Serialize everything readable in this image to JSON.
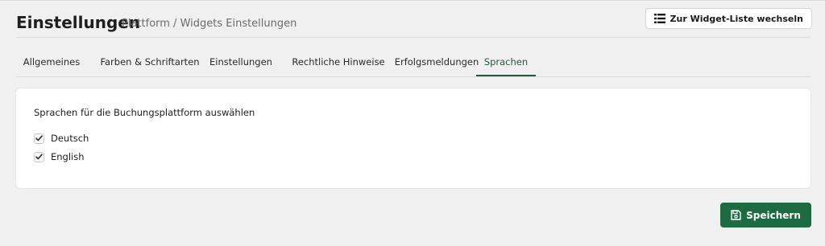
{
  "header": {
    "title": "Einstellungen",
    "breadcrumb": "Plattform / Widgets Einstellungen",
    "widget_list_button": {
      "label": "Zur Widget-Liste wechseln",
      "icon": "list-icon"
    }
  },
  "tabs": [
    {
      "label": "Allgemeines",
      "active": false
    },
    {
      "label": "Farben & Schriftarten",
      "active": false
    },
    {
      "label": "Einstellungen",
      "active": false
    },
    {
      "label": "Rechtliche Hinweise",
      "active": false
    },
    {
      "label": "Erfolgsmeldungen",
      "active": false
    },
    {
      "label": "Sprachen",
      "active": true
    }
  ],
  "languages": {
    "label": "Sprachen für die Buchungsplattform auswählen",
    "options": [
      {
        "label": "Deutsch",
        "checked": true
      },
      {
        "label": "English",
        "checked": true
      }
    ]
  },
  "save_button": {
    "label": "Speichern",
    "icon": "save-icon"
  },
  "colors": {
    "accent": "#1e6b41",
    "active_tab": "#1e5a3c",
    "background": "#f0f0f0"
  }
}
